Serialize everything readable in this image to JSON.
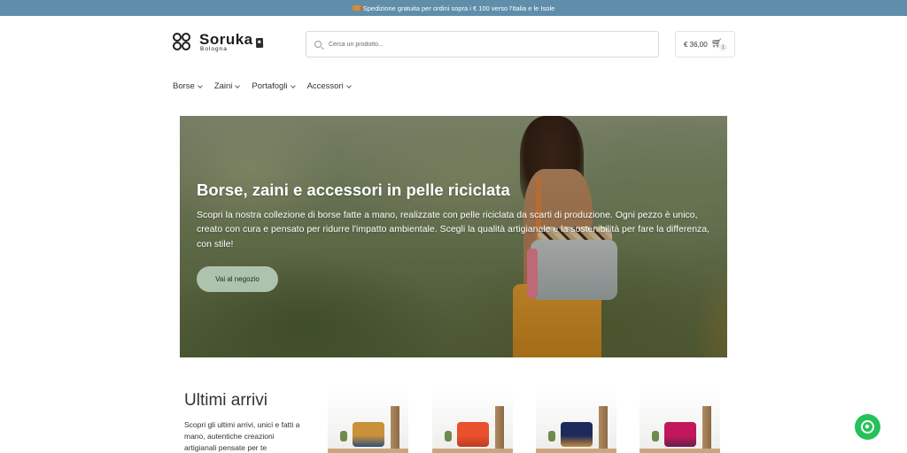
{
  "topbar": {
    "text": "Spedizione gratuita per ordini sopra i € 100 verso l'Italia e le Isole",
    "icon": "truck-icon"
  },
  "logo": {
    "name": "Soruka",
    "subtitle": "Bologna"
  },
  "search": {
    "placeholder": "Cerca un prodotto..."
  },
  "cart": {
    "total": "€ 36,00",
    "count": "1"
  },
  "nav": {
    "items": [
      {
        "label": "Borse"
      },
      {
        "label": "Zaini"
      },
      {
        "label": "Portafogli"
      },
      {
        "label": "Accessori"
      }
    ]
  },
  "hero": {
    "title": "Borse, zaini e accessori in pelle riciclata",
    "description": "Scopri la nostra collezione di borse fatte a mano, realizzate con pelle riciclata da scarti di produzione. Ogni pezzo è unico, creato con cura e pensato per ridurre l'impatto ambientale. Scegli la qualità artigianale e la sostenibilità per fare la differenza, con stile!",
    "button": "Vai al negozio"
  },
  "arrivals": {
    "title": "Ultimi arrivi",
    "text": "Scopri gli ultimi arrivi, unici e fatti a mano, autentiche creazioni artigianali pensate per te"
  },
  "products": [
    {
      "color": "#c8913a",
      "accent": "#2f4f7a"
    },
    {
      "color": "#e8502e",
      "accent": "#bf3b22"
    },
    {
      "color": "#1e2a5a",
      "accent": "#c48a3a"
    },
    {
      "color": "#c2185b",
      "accent": "#6a1b4d"
    }
  ],
  "colors": {
    "topbar": "#5f8eaa",
    "hero_button": "#aec3ad",
    "whatsapp": "#25c25a"
  }
}
